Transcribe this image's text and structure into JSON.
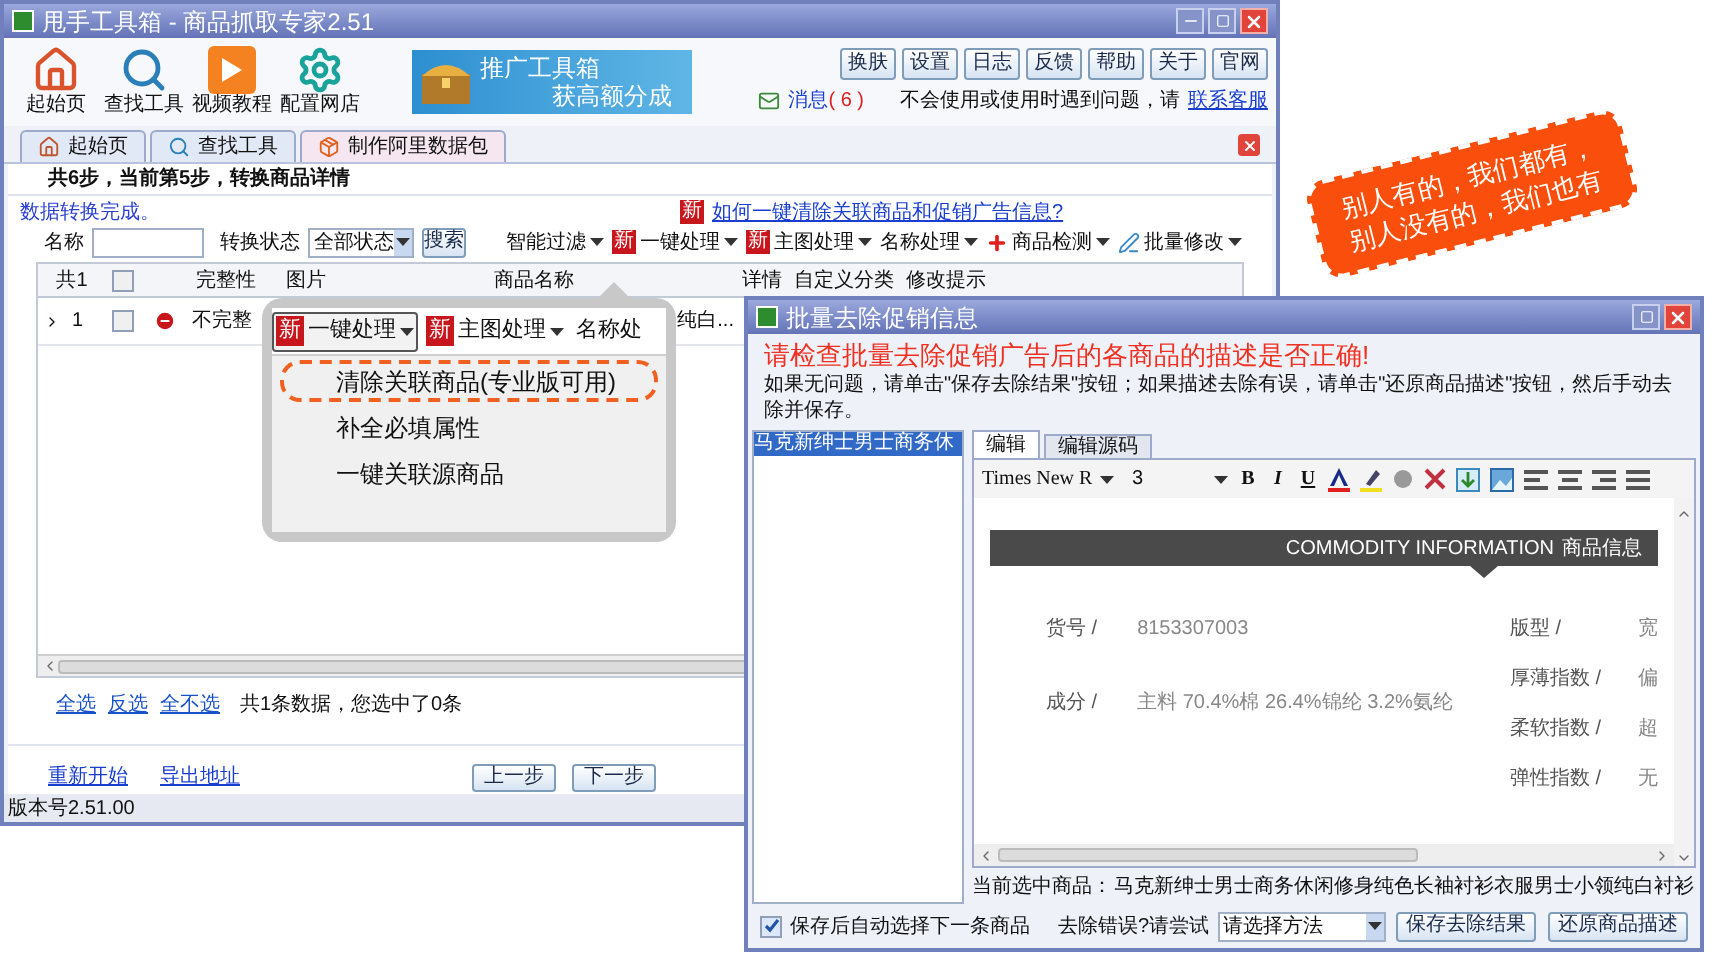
{
  "main_window": {
    "title": "甩手工具箱 - 商品抓取专家2.51",
    "toolbar": [
      {
        "label": "起始页",
        "kind": "home"
      },
      {
        "label": "查找工具",
        "kind": "search"
      },
      {
        "label": "视频教程",
        "kind": "video"
      },
      {
        "label": "配置网店",
        "kind": "settings"
      }
    ],
    "banner": {
      "line1": "推广工具箱",
      "line2": "获高额分成"
    },
    "top_buttons": [
      "换肤",
      "设置",
      "日志",
      "反馈",
      "帮助",
      "关于",
      "官网"
    ],
    "message": {
      "label": "消息",
      "count": "( 6 )"
    },
    "help_text": "不会使用或使用时遇到问题，请",
    "help_link": "联系客服",
    "tabs": [
      {
        "label": "起始页",
        "kind": "home",
        "selected": false
      },
      {
        "label": "查找工具",
        "kind": "search",
        "selected": false
      },
      {
        "label": "制作阿里数据包",
        "kind": "package",
        "selected": true
      }
    ],
    "step_title": "共6步，当前第5步，转换商品详情",
    "status_link": "数据转换完成。",
    "help_question": {
      "tag": "新",
      "label": "如何一键清除关联商品和促销广告信息?"
    },
    "filter": {
      "name_label": "名称",
      "status_label": "转换状态",
      "status_value": "全部状态",
      "search_button": "搜索"
    },
    "actions": [
      {
        "label": "智能过滤",
        "kind": "plain"
      },
      {
        "label": "一键处理",
        "kind": "tag",
        "tag": "新"
      },
      {
        "label": "主图处理",
        "kind": "tag",
        "tag": "新"
      },
      {
        "label": "名称处理",
        "kind": "plain"
      },
      {
        "label": "商品检测",
        "kind": "cross"
      },
      {
        "label": "批量修改",
        "kind": "edit"
      }
    ],
    "table": {
      "count_header": "共1",
      "header_checked": false,
      "columns": [
        "完整性",
        "图片",
        "商品名称",
        "详情",
        "自定义分类",
        "修改提示"
      ],
      "rows": [
        {
          "index": "1",
          "checked": false,
          "completeness": "不完整",
          "name": "纯白..."
        }
      ]
    },
    "selection_links": [
      "全选",
      "反选",
      "全不选"
    ],
    "selection_summary": "共1条数据，您选中了0条",
    "footer_links": [
      "重新开始",
      "导出地址"
    ],
    "nav_buttons": [
      "上一步",
      "下一步"
    ],
    "version": "版本号2.51.00"
  },
  "callout": {
    "buttons": [
      {
        "label": "一键处理",
        "kind": "tag",
        "tag": "新",
        "selected": true
      },
      {
        "label": "主图处理",
        "kind": "tag",
        "tag": "新",
        "selected": false
      },
      {
        "label": "名称处",
        "kind": "plain",
        "selected": false
      }
    ],
    "menu": [
      {
        "label": "清除关联商品(专业版可用)",
        "highlighted": true
      },
      {
        "label": "补全必填属性",
        "highlighted": false
      },
      {
        "label": "一键关联源商品",
        "highlighted": false
      }
    ]
  },
  "badge": {
    "lines": [
      "别人有的，我们都有，",
      "别人没有的，我们也有"
    ]
  },
  "dialog": {
    "title": "批量去除促销信息",
    "warning": "请检查批量去除促销广告后的各商品的描述是否正确!",
    "instructions": "如果无问题，请单击\"保存去除结果\"按钮；如果描述去除有误，请单击\"还原商品描述\"按钮，然后手动去除并保存。",
    "list": [
      {
        "label": "马克新绅士男士商务休",
        "selected": true
      }
    ],
    "editor_tabs": [
      {
        "label": "编辑",
        "selected": true
      },
      {
        "label": "编辑源码",
        "selected": false
      }
    ],
    "font": "Times New R",
    "size": "3",
    "format_buttons": [
      "B",
      "I",
      "U"
    ],
    "content_banner": {
      "en": "COMMODITY INFORMATION",
      "zh": "商品信息"
    },
    "specs_left": [
      {
        "label": "货号 /",
        "value": "8153307003"
      },
      {
        "label": "成分 /",
        "value": "主料  70.4%棉 26.4%锦纶 3.2%氨纶"
      }
    ],
    "specs_right": [
      {
        "label": "版型 /",
        "value": "宽"
      },
      {
        "label": "厚薄指数 /",
        "value": "偏"
      },
      {
        "label": "柔软指数 /",
        "value": "超"
      },
      {
        "label": "弹性指数 /",
        "value": "无"
      }
    ],
    "current_label": "当前选中商品：",
    "current_value": "马克新绅士男士商务休闲修身纯色长袖衬衫衣服男士小领纯白衬衫",
    "auto_next": {
      "label": "保存后自动选择下一条商品",
      "checked": true
    },
    "retry_label": "去除错误?请尝试",
    "method": "请选择方法",
    "buttons": [
      "保存去除结果",
      "还原商品描述"
    ]
  }
}
